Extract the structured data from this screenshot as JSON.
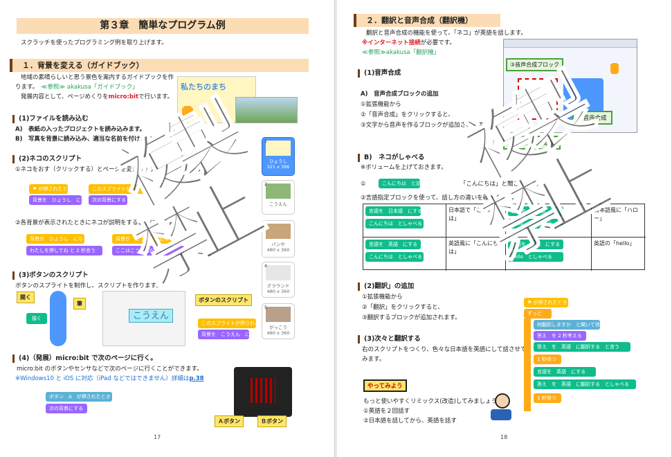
{
  "left": {
    "chapter_title": "第３章　簡単なプログラム例",
    "intro": "スクラッチを使ったプログラミング例を取り上げます。",
    "sec1_title": "１．背景を変える（ガイドブック）",
    "sec1_line1": "地域の素晴らしいと思う景色を案内するガイドブックを作",
    "sec1_line2_a": "ります。",
    "sec1_line2_b": "≪参照≫ akakusa「ガイドブック」",
    "sec1_line3_a": "発展内容として、ページめくりを",
    "sec1_line3_b": "micro:bit",
    "sec1_line3_c": "で行います。",
    "stage_title": "私たちのまち",
    "sub1": "(1)ファイルを読み込む",
    "sub1_a": "A)　表紙の入ったプロジェクトを読み込みます。",
    "sub1_b": "B)　写真を背景に読み込み、適当な名前を付けます。",
    "sub2": "(2)ネコのスクリプト",
    "sub2_line": "①ネコをおす（クリックする）とページを変えるスクリプトを作ります。",
    "blk_flag": "が押されたとき",
    "blk_bg1": "背景を　ひょうし　にする",
    "blk_sprite_click": "このスプライトが押されたとき",
    "blk_next_bg": "次の背景にする",
    "sub2_line2": "②各背景が表示されたときにネコが説明をするようにします。",
    "blk_bg_when": "背景が　ひょうし　になったとき",
    "blk_say1": "わたしを押してね",
    "blk_say_sec1": "2",
    "blk_say_unit": "秒言う",
    "blk_bg_when2": "背景が　こうえん　になったとき",
    "blk_say2": "ここはこうえんだよ",
    "blk_say_sec2": "2",
    "sub3": "(3)ボタンのスクリプト",
    "sub3_line": "ボタンのスプライトを制作し、スクリプトを作ります。",
    "callout_open": "開く",
    "callout_brush": "筆",
    "callout_btn_script": "ボタンのスクリプト",
    "btn_label": "こうえん",
    "blk_sprite_click2": "このスプライトが押されたとき",
    "blk_bg_koen": "背景を　こうえん　にする",
    "draw_label": "描く",
    "sub4": "(4)（発展）micro:bit で次のページに行く。",
    "sub4_line": "micro:bit のボタンやセンサなどで次のページに行くことができます。",
    "sub4_note_a": "※Windows10 と iOS に対応（iPad などではできません）詳細は",
    "sub4_note_link": "p.38",
    "blk_mb": "ボタン　A　が押されたとき",
    "blk_mb_next": "次の背景にする",
    "callout_a": "Ａボタン",
    "callout_b": "Ｂボタン",
    "thumbs": [
      {
        "num": "1",
        "label": "ひょうし",
        "size": "321 x 386"
      },
      {
        "num": "2",
        "label": "こうえん",
        "size": ""
      },
      {
        "num": "3",
        "label": "パンや",
        "size": "480 x 360"
      },
      {
        "num": "4",
        "label": "グラウンド",
        "size": "480 x 360"
      },
      {
        "num": "5",
        "label": "がっこう",
        "size": "480 x 360"
      }
    ],
    "page_number": "17",
    "stamp1": "複",
    "stamp2": "製",
    "stamp3": "禁",
    "stamp4": "止"
  },
  "right": {
    "sec2_title": "２．翻訳と音声合成（翻訳機）",
    "sec2_line1": "翻訳と音声合成の機能を使って、「ネコ」が英語を話します。",
    "sec2_line2_a": "※",
    "sec2_line2_b": "インターネット接続",
    "sec2_line2_c": "が必要です。",
    "sec2_ref": "≪参照≫akakusa「翻訳機」",
    "sub1": "(1)音声合成",
    "subA": "A)　音声合成ブロックの追加",
    "subA_1": "①拡張機能から",
    "subA_2": "②「音声合成」をクリックすると、",
    "subA_3": "③文字から音声を作るブロックが追加されます。",
    "callout_speech_block": "③音声合成ブロック",
    "callout_speech": "②音声合成",
    "callout_ext": "①拡張機能の追加",
    "subB": "B)　ネコがしゃべる",
    "subB_line": "※ボリュームを上げておきます。",
    "subB_1": "①",
    "blk_speak": "こんにちは　と話す",
    "subB_1b": "「こんにちは」と聞こえます。",
    "subB_2": "②言語指定ブロックを使って、話し方の違いを確かめます。",
    "table": [
      {
        "blk1": "言語を　日本語　にする",
        "blk2": "こんにちは　としゃべる",
        "desc": "日本語で「こんにちは」"
      },
      {
        "blk1": "言語を　日本語　にする",
        "blk2": "hello　としゃべる",
        "desc": "日本語風に「ハロー」"
      },
      {
        "blk1": "言語を　英語　にする",
        "blk2": "こんにちは　としゃべる",
        "desc": "英語風に「こんにちは」"
      },
      {
        "blk1": "言語を　英語　にする",
        "blk2": "hello　としゃべる",
        "desc": "英語の「hello」"
      }
    ],
    "sub2": "(2)翻訳」の追加",
    "sub2_1": "①拡張機能から",
    "sub2_2": "②「翻訳」をクリックすると、",
    "sub2_3": "③翻訳するブロックが追加されます。",
    "sub3": "(3)次々と翻訳する",
    "sub3_line1": "右のスクリプトをつくり、色々な日本語を英語にして話させて",
    "sub3_line2": "みます。",
    "try_label": "やってみよう",
    "try_line": "もっと使いやすくリミックス(改造)してみましょう。",
    "try_1": "①英語を２回話す",
    "try_2": "②日本語を話してから、英語を話す",
    "scr_flag": "が押されたとき",
    "scr_forever": "ずっと",
    "scr_ask": "何翻訳しますか　と聞いて待つ",
    "scr_answer_say": "答え　を 2 秒考える",
    "scr_translate_say": "答え　を　英語　に翻訳する　と言う",
    "scr_wait1": "1 秒待つ",
    "scr_lang": "言語を　英語　にする",
    "scr_speak": "答え　を　英語　に翻訳する　としゃべる",
    "scr_wait2": "1 秒待つ",
    "page_number": "18",
    "stamp1": "複",
    "stamp2": "製",
    "stamp3": "禁",
    "stamp4": "止"
  }
}
